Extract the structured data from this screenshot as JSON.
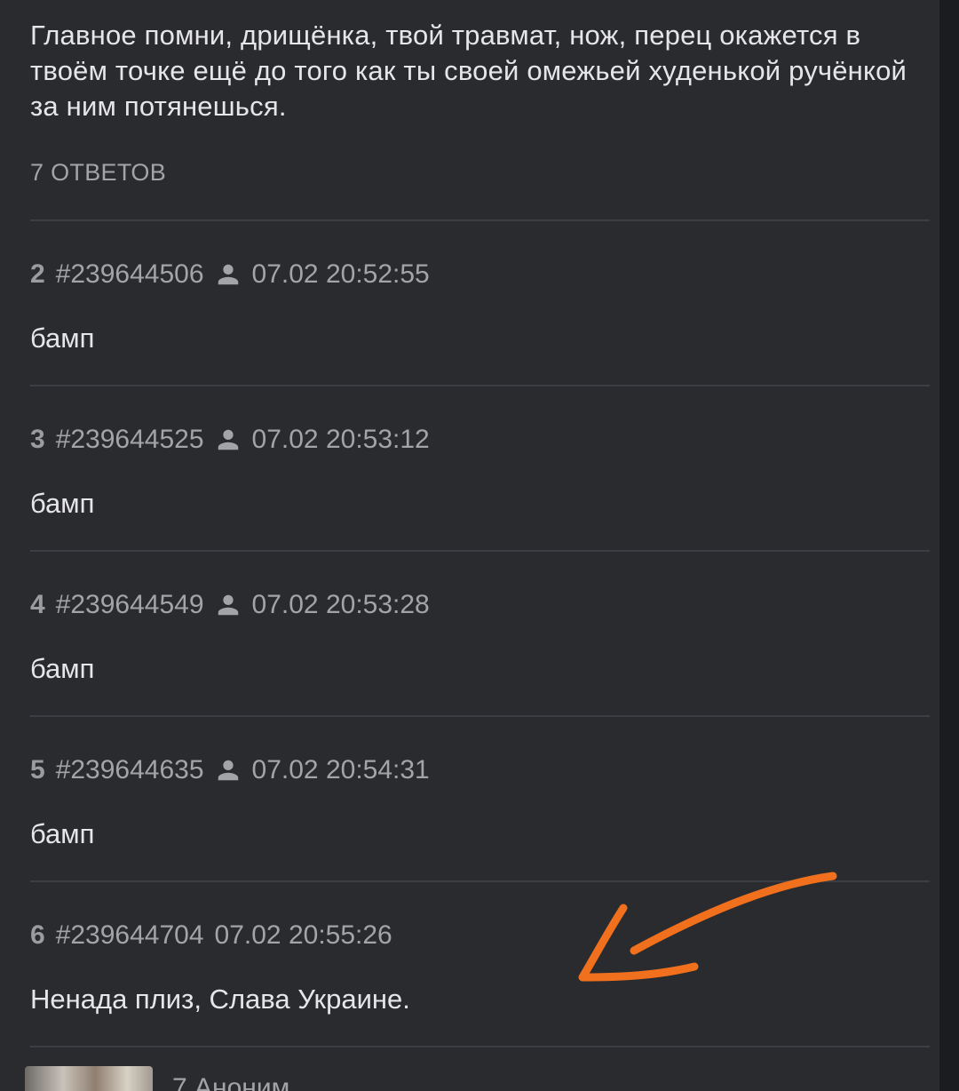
{
  "op": {
    "text": "Главное помни, дрищёнка, твой травмат, нож, перец окажется в твоём точке ещё до того как ты своей омежьей худенькой ручёнкой за ним потянешься.",
    "replies_label": "7 ОТВЕТОВ"
  },
  "posts": [
    {
      "num": "2",
      "id": "#239644506",
      "time": "07.02 20:52:55",
      "body": "бамп",
      "has_user_icon": true
    },
    {
      "num": "3",
      "id": "#239644525",
      "time": "07.02 20:53:12",
      "body": "бамп",
      "has_user_icon": true
    },
    {
      "num": "4",
      "id": "#239644549",
      "time": "07.02 20:53:28",
      "body": "бамп",
      "has_user_icon": true
    },
    {
      "num": "5",
      "id": "#239644635",
      "time": "07.02 20:54:31",
      "body": "бамп",
      "has_user_icon": true
    },
    {
      "num": "6",
      "id": "#239644704",
      "time": "07.02 20:55:26",
      "body": "Ненада плиз, Слава Украине.",
      "has_user_icon": false
    }
  ],
  "next_post": {
    "header": "7 Аноним"
  },
  "colors": {
    "background": "#2a2b2f",
    "text": "#e6e6e8",
    "meta": "#a3a4a8",
    "divider": "#3d3e43",
    "annotation": "#f0701e"
  }
}
